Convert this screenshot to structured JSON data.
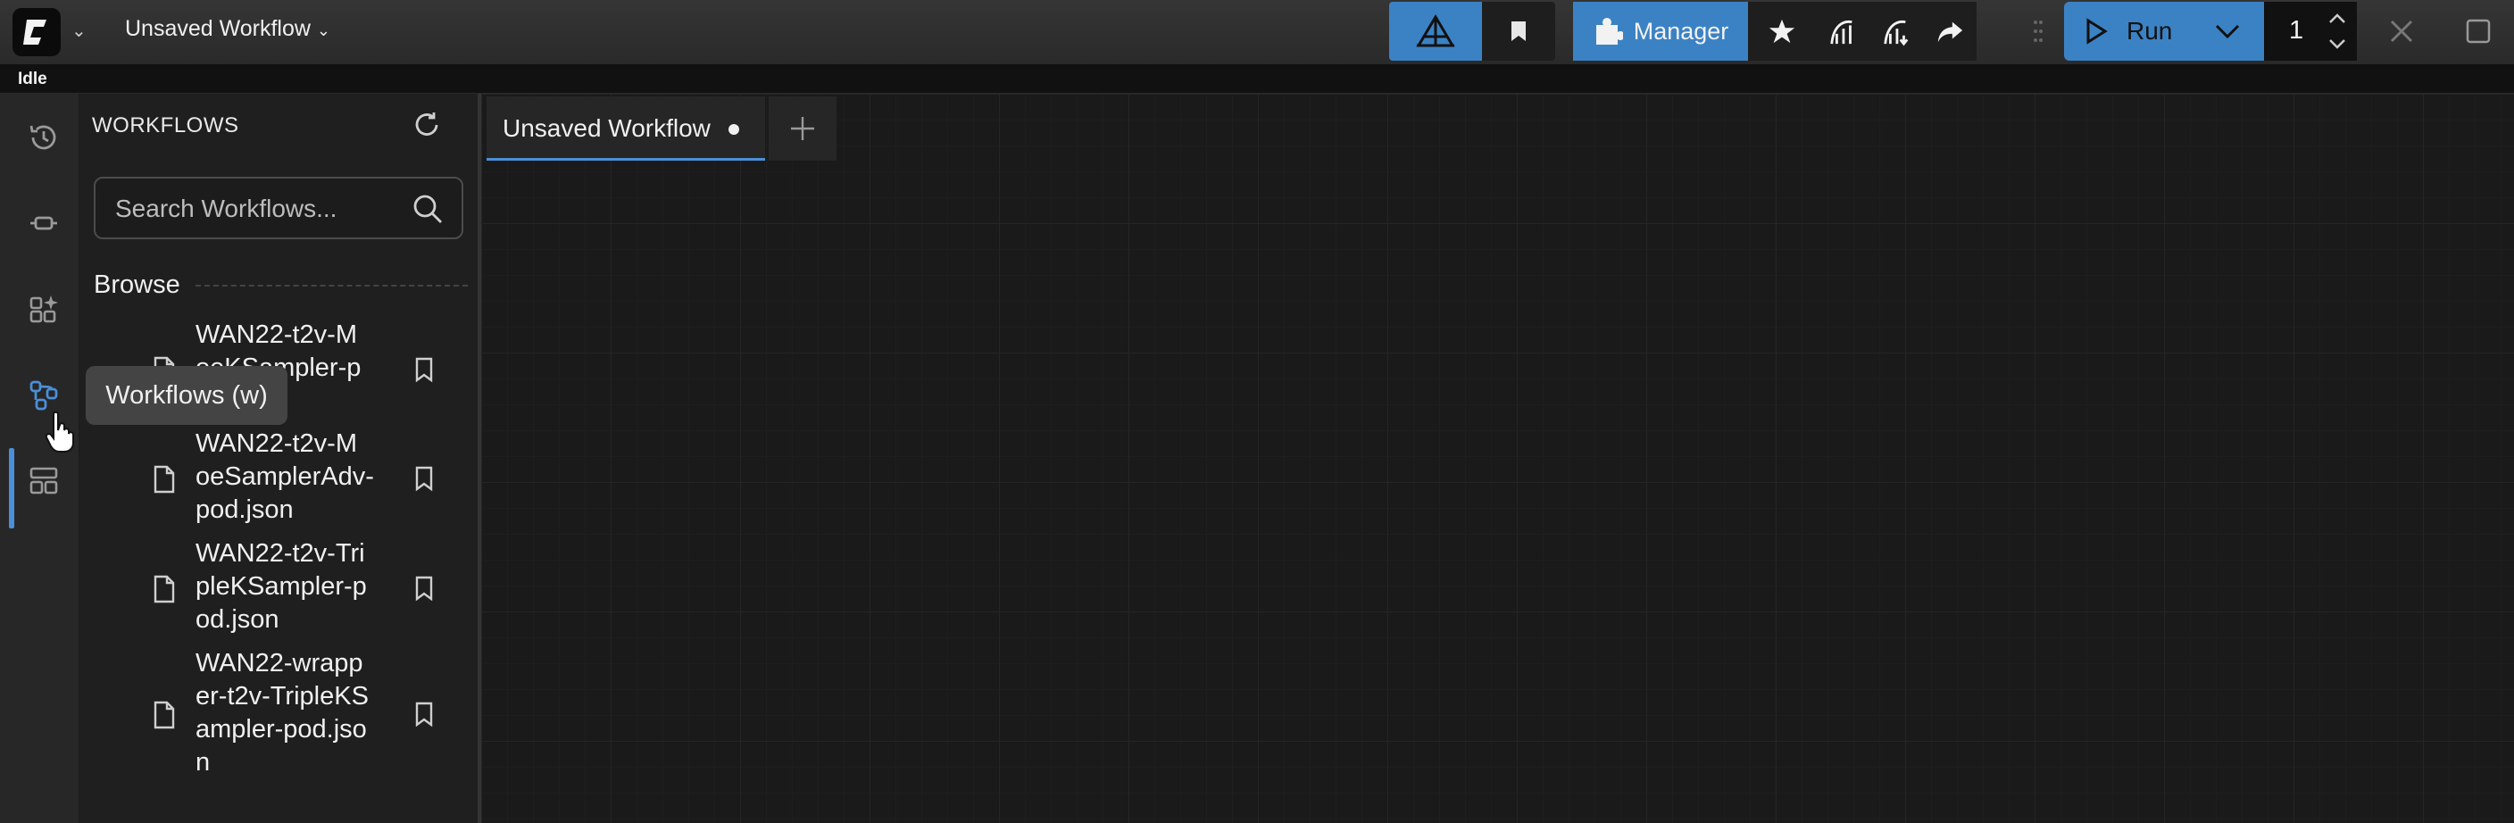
{
  "app": {
    "workflow_title": "Unsaved Workflow",
    "status": "Idle",
    "accent_color": "#3b82c4"
  },
  "toolbar": {
    "manager_label": "Manager",
    "run_label": "Run",
    "queue_count": "1",
    "icons": [
      "comfy-logo-icon",
      "chevron-down-icon",
      "mask-editor-icon",
      "bookmark-icon",
      "puzzle-icon",
      "star-icon",
      "model-icon",
      "model-download-icon",
      "share-icon",
      "drag-handle-icon",
      "play-icon",
      "spinner-up-icon",
      "spinner-down-icon",
      "close-icon",
      "maximize-icon"
    ]
  },
  "sidebar": {
    "icons": [
      "history-icon",
      "node-library-icon",
      "model-library-icon",
      "workflows-icon",
      "templates-icon"
    ],
    "active": "workflows"
  },
  "workflows_panel": {
    "header": "WORKFLOWS",
    "search_placeholder": "Search Workflows...",
    "browse_label": "Browse",
    "items": [
      {
        "lines": [
          "WAN22-t2v-M",
          "oeKSampler-p",
          "od.json"
        ]
      },
      {
        "lines": [
          "WAN22-t2v-M",
          "oeSamplerAdv-",
          "pod.json"
        ]
      },
      {
        "lines": [
          "WAN22-t2v-Tri",
          "pleKSampler-p",
          "od.json"
        ]
      },
      {
        "lines": [
          "WAN22-wrapp",
          "er-t2v-TripleKS",
          "ampler-pod.jso",
          "n"
        ]
      }
    ]
  },
  "tooltip": "Workflows (w)",
  "tabs": [
    {
      "label": "Unsaved Workflow",
      "modified": true
    }
  ]
}
